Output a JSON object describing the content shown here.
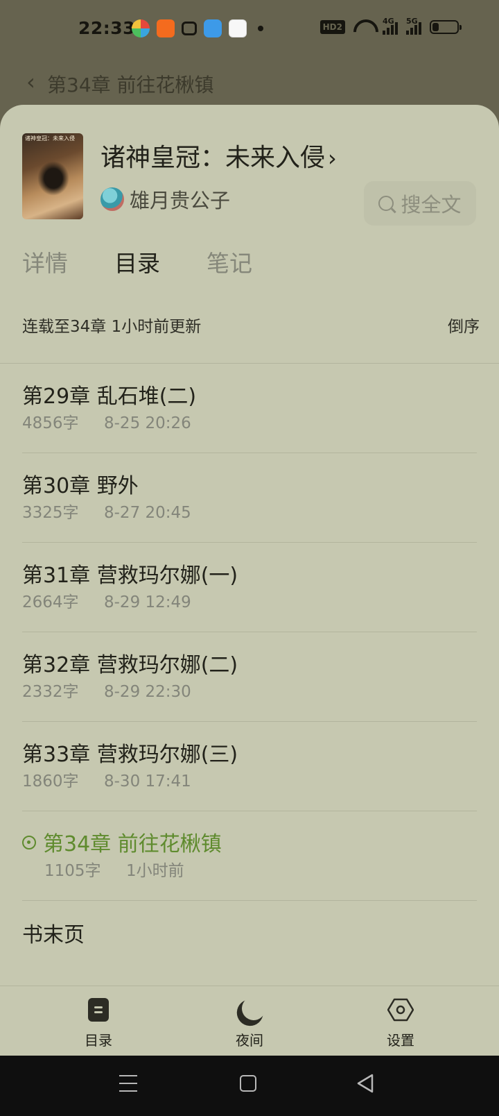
{
  "status_bar": {
    "time": "22:33",
    "hd_badge": "HD2",
    "signal_1_label": "4G",
    "signal_2_label": "5G",
    "battery_level": 0.25
  },
  "reader_header": {
    "chapter_title": "第34章 前往花楸镇",
    "back_icon": "chevron-left-icon"
  },
  "book": {
    "cover_text": "诸神皇冠：未来入侵",
    "title": "诸神皇冠：未来入侵",
    "title_chevron": "›",
    "author": "雄月贵公子",
    "search_label": "搜全文"
  },
  "tabs": [
    {
      "label": "详情",
      "active": false
    },
    {
      "label": "目录",
      "active": true
    },
    {
      "label": "笔记",
      "active": false
    }
  ],
  "toc": {
    "status": "连载至34章 1小时前更新",
    "sort_label": "倒序",
    "chapters": [
      {
        "title": "第29章 乱石堆(二)",
        "words": "4856字",
        "time": "8-25 20:26",
        "current": false
      },
      {
        "title": "第30章 野外",
        "words": "3325字",
        "time": "8-27 20:45",
        "current": false
      },
      {
        "title": "第31章 营救玛尔娜(一)",
        "words": "2664字",
        "time": "8-29 12:49",
        "current": false
      },
      {
        "title": "第32章 营救玛尔娜(二)",
        "words": "2332字",
        "time": "8-29 22:30",
        "current": false
      },
      {
        "title": "第33章 营救玛尔娜(三)",
        "words": "1860字",
        "time": "8-30 17:41",
        "current": false
      },
      {
        "title": "第34章 前往花楸镇",
        "words": "1105字",
        "time": "1小时前",
        "current": true
      }
    ],
    "end_page": "书末页"
  },
  "toolbar": {
    "toc_label": "目录",
    "night_label": "夜间",
    "settings_label": "设置"
  },
  "colors": {
    "sheet_bg": "#c6c8b0",
    "accent_current": "#5f8b2e",
    "dim_bg": "#66634f"
  }
}
